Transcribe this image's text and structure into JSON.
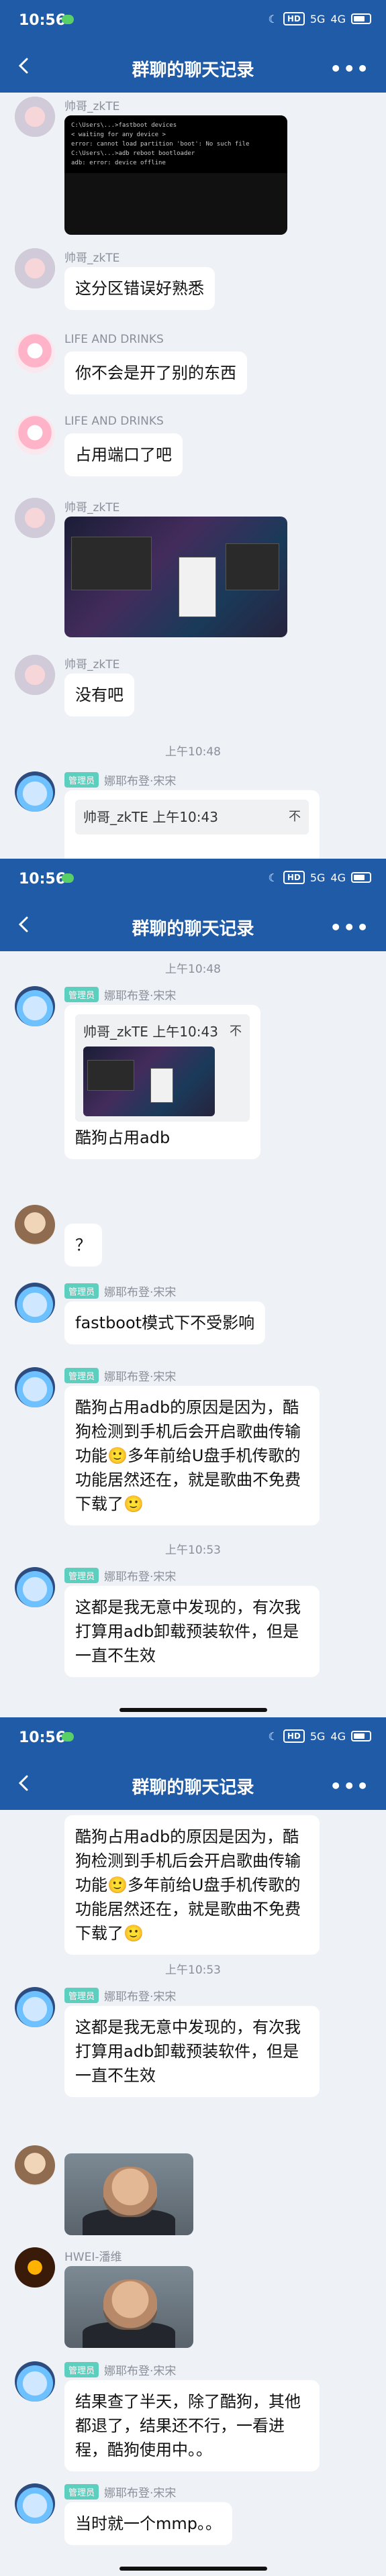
{
  "status": {
    "time": "10:56",
    "hd": "HD",
    "net": "5G",
    "signal": "4G",
    "battery": "83"
  },
  "nav": {
    "title": "群聊的聊天记录"
  },
  "users": {
    "a": "帅哥_zkTE",
    "b": "LIFE AND DRINKS",
    "c": "娜耶布登·宋宋",
    "d": "HWEI-潘维",
    "admin_badge": "管理员"
  },
  "panel1": {
    "msg2": "这分区错误好熟悉",
    "msg3": "你不会是开了别的东西",
    "msg4": "占用端口了吧",
    "msg6": "没有吧",
    "time1": "上午10:48",
    "quote": "帅哥_zkTE 上午10:43"
  },
  "panel2": {
    "time1": "上午10:48",
    "quote": "帅哥_zkTE 上午10:43",
    "quote_reply": "酷狗占用adb",
    "q": "？",
    "fb": "fastboot模式下不受影响",
    "long": "酷狗占用adb的原因是因为，酷狗检测到手机后会开启歌曲传输功能🙂多年前给U盘手机传歌的功能居然还在，就是歌曲不免费下载了🙂",
    "time2": "上午10:53",
    "found": "这都是我无意中发现的，有次我打算用adb卸载预装软件，但是一直不生效"
  },
  "panel3": {
    "long": "酷狗占用adb的原因是因为，酷狗检测到手机后会开启歌曲传输功能🙂多年前给U盘手机传歌的功能居然还在，就是歌曲不免费下载了🙂",
    "time2": "上午10:53",
    "found": "这都是我无意中发现的，有次我打算用adb卸载预装软件，但是一直不生效",
    "result": "结果查了半天，除了酷狗，其他都退了，结果还不行，一看进程，酷狗使用中。。",
    "last": "当时就一个mmp。。"
  },
  "terminal_lines": [
    "C:\\Users\\...>fastboot devices",
    "< waiting for any device >",
    "error: cannot load partition 'boot': No such file",
    "",
    "C:\\Users\\...>adb reboot bootloader",
    "adb: error: device offline"
  ]
}
